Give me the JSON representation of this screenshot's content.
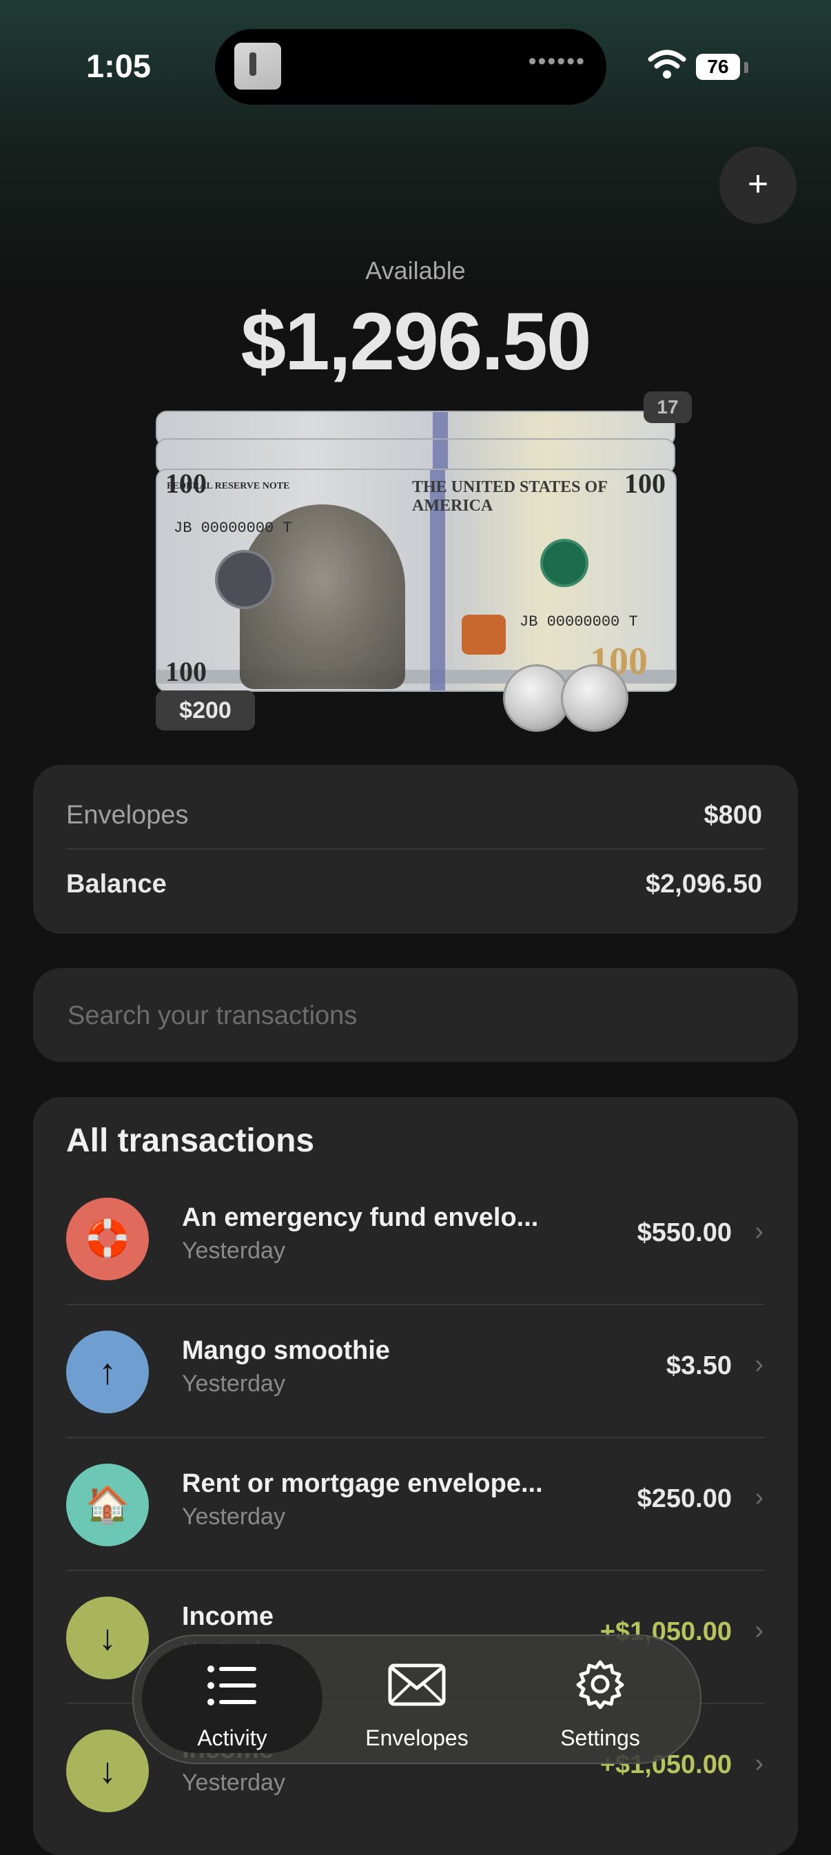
{
  "status_bar": {
    "time": "1:05",
    "battery": "76"
  },
  "header": {
    "add_label": "+"
  },
  "balance": {
    "available_label": "Available",
    "available_amount": "$1,296.50"
  },
  "cash": {
    "count_badge": "17",
    "denomination_label": "$200",
    "bill_value": "100",
    "serial": "JB 00000000 T"
  },
  "summary": {
    "envelopes_label": "Envelopes",
    "envelopes_value": "$800",
    "balance_label": "Balance",
    "balance_value": "$2,096.50"
  },
  "search": {
    "placeholder": "Search your transactions"
  },
  "transactions": {
    "title": "All transactions",
    "items": [
      {
        "name": "An emergency fund envelo...",
        "date": "Yesterday",
        "amount": "$550.00",
        "icon": "lifebuoy-icon",
        "glyph": "🛟",
        "color": "#e06b5c"
      },
      {
        "name": "Mango smoothie",
        "date": "Yesterday",
        "amount": "$3.50",
        "icon": "arrow-up-icon",
        "glyph": "↑",
        "color": "#6f9fd0"
      },
      {
        "name": "Rent or mortgage envelope...",
        "date": "Yesterday",
        "amount": "$250.00",
        "icon": "house-icon",
        "glyph": "🏠",
        "color": "#6cc8b4"
      },
      {
        "name": "Income",
        "date": "Yesterday",
        "amount": "+$1,050.00",
        "icon": "arrow-down-icon",
        "glyph": "↓",
        "color": "#a9b55a"
      },
      {
        "name": "Income",
        "date": "Yesterday",
        "amount": "+$1,050.00",
        "icon": "arrow-down-icon",
        "glyph": "↓",
        "color": "#a9b55a"
      }
    ]
  },
  "tabbar": {
    "activity": "Activity",
    "envelopes": "Envelopes",
    "settings": "Settings"
  },
  "colors": {
    "positive": "#b5c45d",
    "card": "#262626",
    "background": "#121212"
  }
}
